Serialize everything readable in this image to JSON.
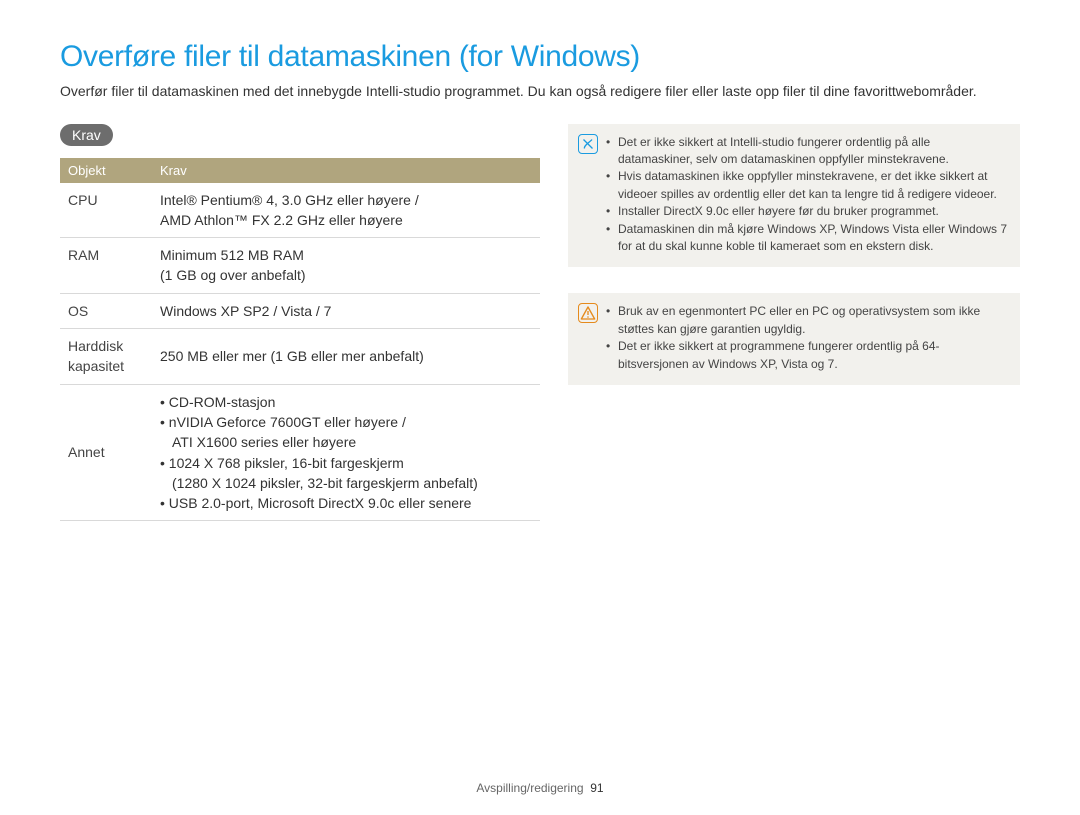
{
  "title": "Overføre filer til datamaskinen (for Windows)",
  "intro": "Overfør filer til datamaskinen med det innebygde Intelli-studio programmet. Du kan også redigere filer eller laste opp filer til dine favorittwebområder.",
  "section_krav_label": "Krav",
  "req_table": {
    "headers": {
      "objekt": "Objekt",
      "krav": "Krav"
    },
    "rows": {
      "cpu": {
        "label": "CPU",
        "line1": "Intel® Pentium® 4, 3.0 GHz eller høyere /",
        "line2": "AMD Athlon™ FX 2.2 GHz eller høyere"
      },
      "ram": {
        "label": "RAM",
        "line1": "Minimum 512 MB RAM",
        "line2": "(1 GB og over anbefalt)"
      },
      "os": {
        "label": "OS",
        "value": "Windows XP SP2 / Vista / 7"
      },
      "hdd": {
        "label1": "Harddisk",
        "label2": "kapasitet",
        "value": "250 MB eller mer (1 GB eller mer anbefalt)"
      },
      "annet": {
        "label": "Annet",
        "items": {
          "i0": "CD-ROM-stasjon",
          "i1a": "nVIDIA Geforce 7600GT eller høyere /",
          "i1b": "ATI X1600 series eller høyere",
          "i2a": "1024 X 768 piksler, 16-bit fargeskjerm",
          "i2b": "(1280 X 1024 piksler, 32-bit fargeskjerm anbefalt)",
          "i3": "USB 2.0-port, Microsoft DirectX 9.0c eller senere"
        }
      }
    }
  },
  "note_box": {
    "b0": "Det er ikke sikkert at Intelli-studio fungerer ordentlig på alle datamaskiner, selv om datamaskinen oppfyller minstekravene.",
    "b1": "Hvis datamaskinen ikke oppfyller minstekravene, er det ikke sikkert at videoer spilles av ordentlig eller det kan ta lengre tid å redigere videoer.",
    "b2": "Installer DirectX 9.0c eller høyere før du bruker programmet.",
    "b3": "Datamaskinen din må kjøre Windows XP, Windows Vista eller Windows 7 for at du skal kunne koble til kameraet som en ekstern disk."
  },
  "warn_box": {
    "b0": "Bruk av en egenmontert PC eller en PC og operativsystem som ikke støttes kan gjøre garantien ugyldig.",
    "b1": "Det er ikke sikkert at programmene fungerer ordentlig på 64-bitsversjonen av Windows XP, Vista og 7."
  },
  "footer": {
    "section": "Avspilling/redigering",
    "page": "91"
  }
}
